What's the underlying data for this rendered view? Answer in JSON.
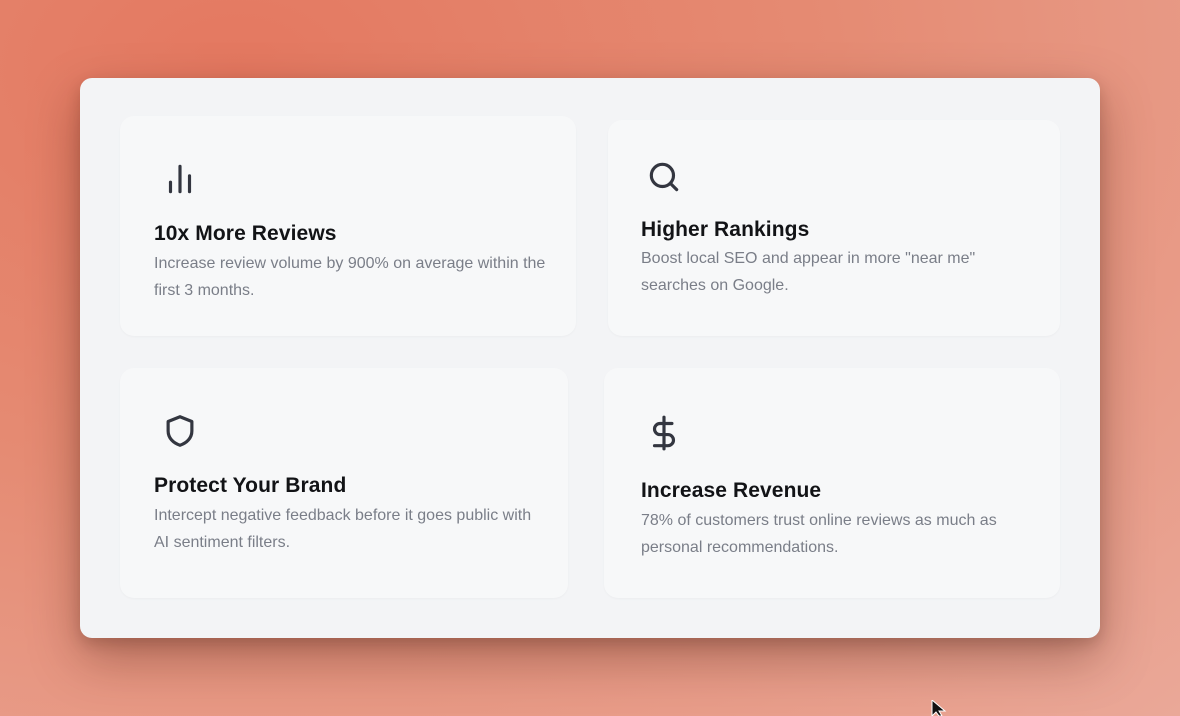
{
  "features": [
    {
      "icon": "bar-chart-icon",
      "title": "10x More Reviews",
      "description": "Increase review volume by 900% on average within the first 3 months."
    },
    {
      "icon": "search-icon",
      "title": "Higher Rankings",
      "description": "Boost local SEO and appear in more \"near me\" searches on Google."
    },
    {
      "icon": "shield-icon",
      "title": "Protect Your Brand",
      "description": "Intercept negative feedback before it goes public with AI sentiment filters."
    },
    {
      "icon": "dollar-sign-icon",
      "title": "Increase Revenue",
      "description": "78% of customers trust online reviews as much as personal recommendations."
    }
  ]
}
